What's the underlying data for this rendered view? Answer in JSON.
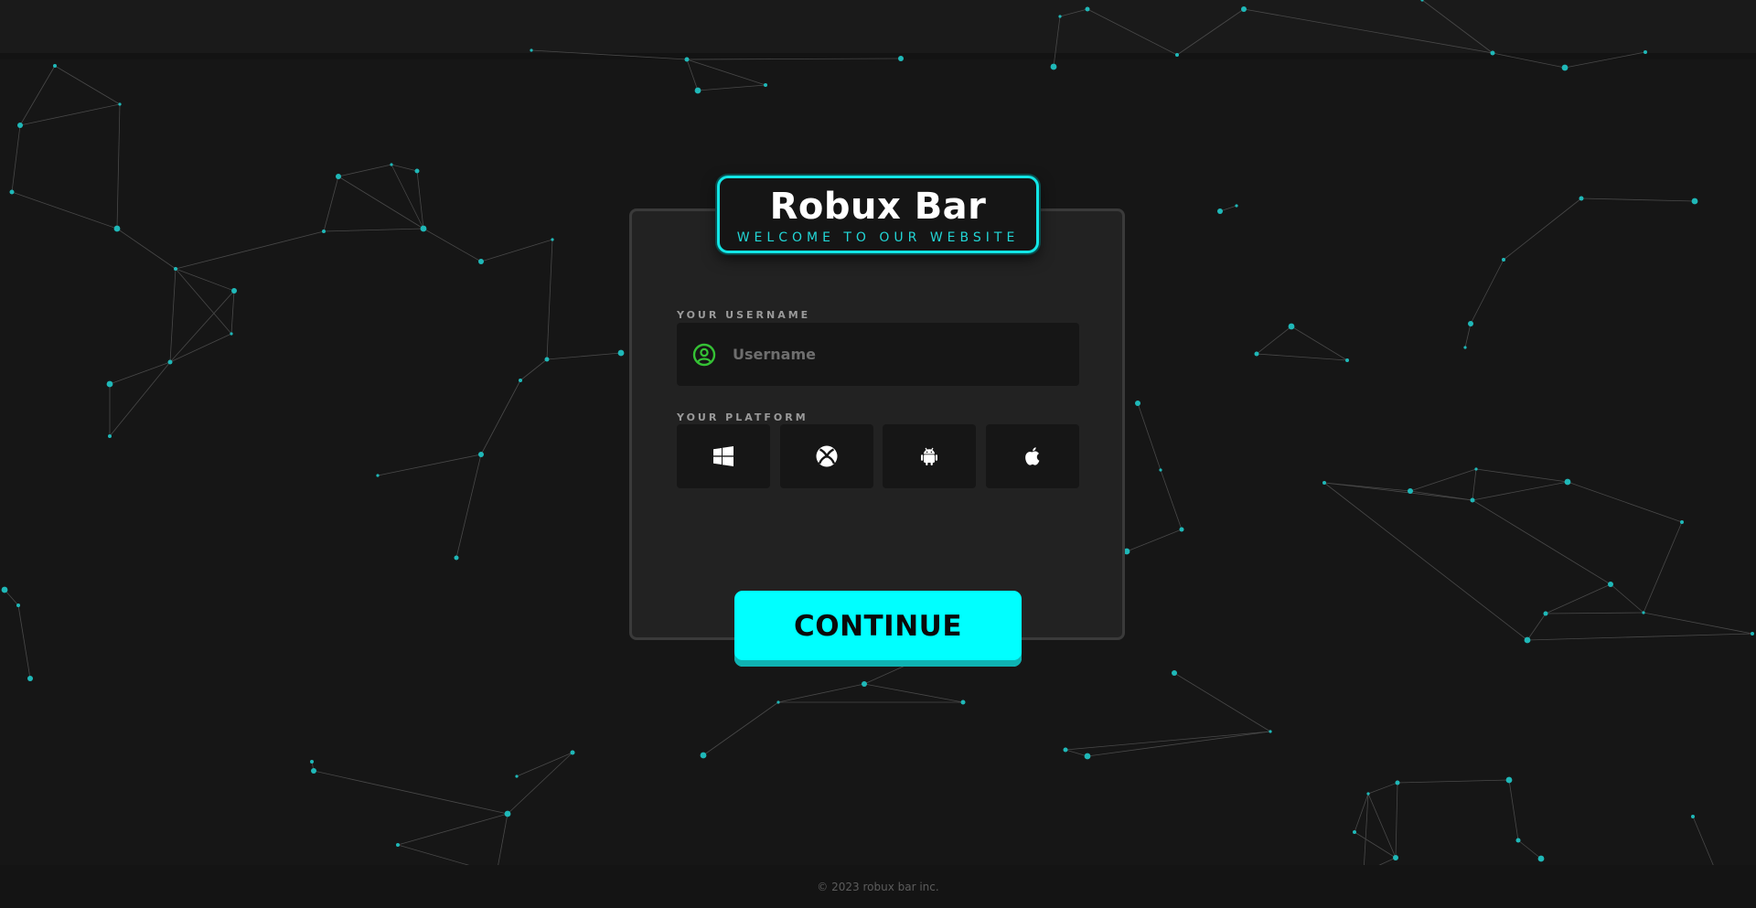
{
  "brand": {
    "title": "Robux Bar",
    "subtitle": "WELCOME TO OUR WEBSITE"
  },
  "form": {
    "username_label": "YOUR USERNAME",
    "username_placeholder": "Username",
    "username_value": "",
    "platform_label": "YOUR PLATFORM",
    "platforms": [
      {
        "name": "windows",
        "icon": "windows-icon"
      },
      {
        "name": "xbox",
        "icon": "xbox-icon"
      },
      {
        "name": "android",
        "icon": "android-icon"
      },
      {
        "name": "apple",
        "icon": "apple-icon"
      }
    ],
    "continue_label": "CONTINUE"
  },
  "footer": {
    "copyright": "© 2023 robux bar inc."
  },
  "colors": {
    "accent": "#00ffff",
    "accent_dark": "#0fb3b3",
    "user_icon": "#35c235",
    "background": "#161616",
    "card": "#222222",
    "network_node": "#1fb8b8",
    "network_line": "#5a5a5a"
  }
}
